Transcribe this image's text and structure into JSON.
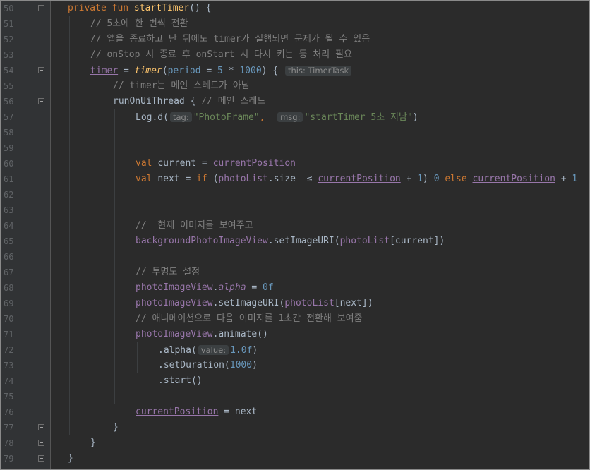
{
  "lines": [
    {
      "n": "50",
      "tokens": [
        {
          "t": "private fun ",
          "c": "kw"
        },
        {
          "t": "startTimer",
          "c": "fn"
        },
        {
          "t": "() {",
          "c": ""
        }
      ],
      "indent": 0
    },
    {
      "n": "51",
      "tokens": [
        {
          "t": "// 5초에 한 번씩 전환",
          "c": "cm"
        }
      ],
      "indent": 1
    },
    {
      "n": "52",
      "tokens": [
        {
          "t": "// 앱을 종료하고 난 뒤에도 timer가 실행되면 문제가 될 수 있음",
          "c": "cm"
        }
      ],
      "indent": 1
    },
    {
      "n": "53",
      "tokens": [
        {
          "t": "// onStop 시 종료 후 onStart 시 다시 키는 등 처리 필요",
          "c": "cm"
        }
      ],
      "indent": 1
    },
    {
      "n": "54",
      "tokens": [
        {
          "t": "timer",
          "c": "prop ul"
        },
        {
          "t": " = ",
          "c": ""
        },
        {
          "t": "timer",
          "c": "fn ital"
        },
        {
          "t": "(",
          "c": ""
        },
        {
          "t": "period",
          "c": "param"
        },
        {
          "t": " = ",
          "c": ""
        },
        {
          "t": "5",
          "c": "num"
        },
        {
          "t": " * ",
          "c": ""
        },
        {
          "t": "1000",
          "c": "num"
        },
        {
          "t": ") { ",
          "c": ""
        },
        {
          "t": "this: TimerTask",
          "c": "hint"
        }
      ],
      "indent": 1
    },
    {
      "n": "55",
      "tokens": [
        {
          "t": "// timer는 메인 스레드가 아님",
          "c": "cm"
        }
      ],
      "indent": 2
    },
    {
      "n": "56",
      "tokens": [
        {
          "t": "runOnUiThread { ",
          "c": ""
        },
        {
          "t": "// 메인 스레드",
          "c": "cm"
        }
      ],
      "indent": 2
    },
    {
      "n": "57",
      "tokens": [
        {
          "t": "Log.d(",
          "c": ""
        },
        {
          "t": "tag:",
          "c": "hint"
        },
        {
          "t": "\"PhotoFrame\"",
          "c": "str"
        },
        {
          "t": ",  ",
          "c": "kw"
        },
        {
          "t": "msg:",
          "c": "hint"
        },
        {
          "t": "\"startTimer 5초 지남\"",
          "c": "str"
        },
        {
          "t": ")",
          "c": ""
        }
      ],
      "indent": 3
    },
    {
      "n": "58",
      "tokens": [],
      "indent": 3
    },
    {
      "n": "59",
      "tokens": [],
      "indent": 3
    },
    {
      "n": "60",
      "tokens": [
        {
          "t": "val ",
          "c": "kw"
        },
        {
          "t": "current = ",
          "c": ""
        },
        {
          "t": "currentPosition",
          "c": "prop ul"
        }
      ],
      "indent": 3
    },
    {
      "n": "61",
      "tokens": [
        {
          "t": "val ",
          "c": "kw"
        },
        {
          "t": "next = ",
          "c": ""
        },
        {
          "t": "if ",
          "c": "kw"
        },
        {
          "t": "(",
          "c": ""
        },
        {
          "t": "photoList",
          "c": "prop"
        },
        {
          "t": ".size ",
          "c": ""
        },
        {
          "t": " ≤ ",
          "c": ""
        },
        {
          "t": "currentPosition",
          "c": "prop ul"
        },
        {
          "t": " + ",
          "c": ""
        },
        {
          "t": "1",
          "c": "num"
        },
        {
          "t": ") ",
          "c": ""
        },
        {
          "t": "0",
          "c": "num"
        },
        {
          "t": " else ",
          "c": "kw"
        },
        {
          "t": "currentPosition",
          "c": "prop ul"
        },
        {
          "t": " + ",
          "c": ""
        },
        {
          "t": "1",
          "c": "num"
        }
      ],
      "indent": 3
    },
    {
      "n": "62",
      "tokens": [],
      "indent": 3
    },
    {
      "n": "63",
      "tokens": [],
      "indent": 3
    },
    {
      "n": "64",
      "tokens": [
        {
          "t": "//  현재 이미지를 보여주고",
          "c": "cm"
        }
      ],
      "indent": 3
    },
    {
      "n": "65",
      "tokens": [
        {
          "t": "backgroundPhotoImageView",
          "c": "prop"
        },
        {
          "t": ".setImageURI(",
          "c": ""
        },
        {
          "t": "photoList",
          "c": "prop"
        },
        {
          "t": "[current])",
          "c": ""
        }
      ],
      "indent": 3
    },
    {
      "n": "66",
      "tokens": [],
      "indent": 3
    },
    {
      "n": "67",
      "tokens": [
        {
          "t": "// 투명도 설정",
          "c": "cm"
        }
      ],
      "indent": 3
    },
    {
      "n": "68",
      "tokens": [
        {
          "t": "photoImageView",
          "c": "prop"
        },
        {
          "t": ".",
          "c": ""
        },
        {
          "t": "alpha",
          "c": "prop ital ul"
        },
        {
          "t": " = ",
          "c": ""
        },
        {
          "t": "0f",
          "c": "num"
        }
      ],
      "indent": 3
    },
    {
      "n": "69",
      "tokens": [
        {
          "t": "photoImageView",
          "c": "prop"
        },
        {
          "t": ".setImageURI(",
          "c": ""
        },
        {
          "t": "photoList",
          "c": "prop"
        },
        {
          "t": "[next])",
          "c": ""
        }
      ],
      "indent": 3
    },
    {
      "n": "70",
      "tokens": [
        {
          "t": "// 애니메이션으로 다음 이미지를 1초간 전환해 보여줌",
          "c": "cm"
        }
      ],
      "indent": 3
    },
    {
      "n": "71",
      "tokens": [
        {
          "t": "photoImageView",
          "c": "prop"
        },
        {
          "t": ".animate()",
          "c": ""
        }
      ],
      "indent": 3
    },
    {
      "n": "72",
      "tokens": [
        {
          "t": ".alpha(",
          "c": ""
        },
        {
          "t": "value:",
          "c": "hint"
        },
        {
          "t": "1.0f",
          "c": "num"
        },
        {
          "t": ")",
          "c": ""
        }
      ],
      "indent": 4
    },
    {
      "n": "73",
      "tokens": [
        {
          "t": ".setDuration(",
          "c": ""
        },
        {
          "t": "1000",
          "c": "num"
        },
        {
          "t": ")",
          "c": ""
        }
      ],
      "indent": 4
    },
    {
      "n": "74",
      "tokens": [
        {
          "t": ".start()",
          "c": ""
        }
      ],
      "indent": 4
    },
    {
      "n": "75",
      "tokens": [],
      "indent": 3
    },
    {
      "n": "76",
      "tokens": [
        {
          "t": "currentPosition",
          "c": "prop ul"
        },
        {
          "t": " = next",
          "c": ""
        }
      ],
      "indent": 3
    },
    {
      "n": "77",
      "tokens": [
        {
          "t": "}",
          "c": ""
        }
      ],
      "indent": 2
    },
    {
      "n": "78",
      "tokens": [
        {
          "t": "}",
          "c": ""
        }
      ],
      "indent": 1
    },
    {
      "n": "79",
      "tokens": [
        {
          "t": "}",
          "c": ""
        }
      ],
      "indent": 0
    }
  ],
  "fold_markers": [
    "50",
    "54",
    "56",
    "77",
    "78",
    "79"
  ],
  "colors": {
    "background": "#2b2b2b",
    "gutter": "#313335",
    "keyword": "#cc7832",
    "function": "#ffc66d",
    "comment": "#808080",
    "string": "#6a8759",
    "number": "#6897bb",
    "property": "#9876aa",
    "text": "#a9b7c6"
  }
}
